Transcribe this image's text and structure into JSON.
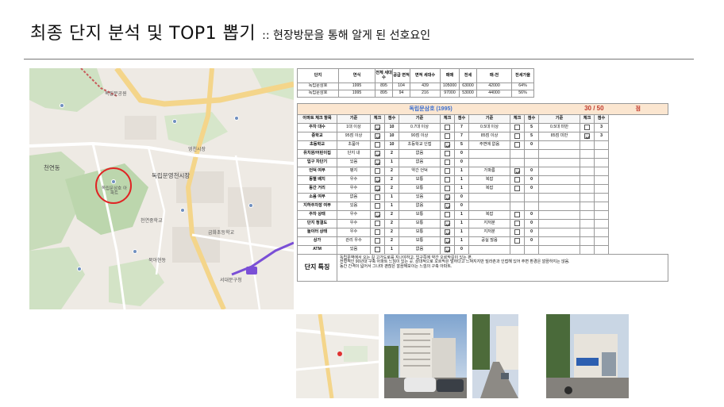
{
  "title": {
    "main": "최종 단지 분석 및 TOP1 뽑기",
    "sub": ":: 현장방문을 통해 알게 된 선호요인"
  },
  "map": {
    "labels": [
      "독립문공원",
      "천연동",
      "독립문영천시장",
      "독립문삼호 아파트",
      "영천시장",
      "천연중학교",
      "금화초등학교",
      "서대문구청",
      "북아현동"
    ],
    "circled": "독립문삼호 아파트"
  },
  "summary": {
    "headers": [
      "단지",
      "연식",
      "전체 세대수",
      "공급 면적",
      "면적 세대수",
      "매매",
      "전세",
      "매-전",
      "전세가율"
    ],
    "rows": [
      [
        "독립문삼호",
        "1995",
        "895",
        "104",
        "439",
        "105000",
        "63000",
        "42000",
        "64%"
      ],
      [
        "독립문삼호",
        "1995",
        "895",
        "94",
        "216",
        "97000",
        "53000",
        "44000",
        "56%"
      ]
    ]
  },
  "analysis": {
    "complex_name": "독립문삼호 (1995)",
    "total_score": "30 / 50",
    "score_unit": "점",
    "headers": [
      "아파트 체크 항목",
      "기준",
      "체크",
      "점수",
      "기준",
      "체크",
      "점수",
      "기준",
      "체크",
      "점수",
      "기준",
      "체크",
      "점수"
    ],
    "rows": [
      {
        "item": "주차 대수",
        "g": [
          [
            "1대 이상",
            true,
            "10"
          ],
          [
            "0.7대 이상",
            false,
            "7"
          ],
          [
            "0.5대 이상",
            false,
            "5"
          ],
          [
            "0.5대 미만",
            false,
            "3"
          ]
        ]
      },
      {
        "item": "중학교",
        "g": [
          [
            "95점 이상",
            true,
            "10"
          ],
          [
            "90점 이상",
            false,
            "7"
          ],
          [
            "85점 이상",
            false,
            "5"
          ],
          [
            "85점 미만",
            true,
            "3"
          ]
        ]
      },
      {
        "item": "초등학교",
        "g": [
          [
            "초품아",
            false,
            "10"
          ],
          [
            "초등학교 인접",
            true,
            "5"
          ],
          [
            "주변에 없음",
            false,
            "0"
          ],
          null
        ]
      },
      {
        "item": "유치원/어린이집",
        "g": [
          [
            "단지 내",
            true,
            "2"
          ],
          [
            "없음",
            false,
            "0"
          ],
          null,
          null
        ]
      },
      {
        "item": "입구 차단기",
        "g": [
          [
            "있음",
            true,
            "1"
          ],
          [
            "없음",
            false,
            "0"
          ],
          null,
          null
        ]
      },
      {
        "item": "언덕 여부",
        "g": [
          [
            "평지",
            false,
            "2"
          ],
          [
            "약간 언덕",
            false,
            "1"
          ],
          [
            "가파름",
            true,
            "0"
          ],
          null
        ]
      },
      {
        "item": "동별 배치",
        "g": [
          [
            "우수",
            true,
            "2"
          ],
          [
            "보통",
            false,
            "1"
          ],
          [
            "복잡",
            false,
            "0"
          ],
          null
        ]
      },
      {
        "item": "동간 거리",
        "g": [
          [
            "우수",
            true,
            "2"
          ],
          [
            "보통",
            false,
            "1"
          ],
          [
            "복잡",
            false,
            "0"
          ],
          null
        ]
      },
      {
        "item": "소음 여부",
        "g": [
          [
            "없음",
            false,
            "1"
          ],
          [
            "있음",
            true,
            "0"
          ],
          null,
          null
        ]
      },
      {
        "item": "지하주차장 여부",
        "g": [
          [
            "있음",
            false,
            "1"
          ],
          [
            "없음",
            true,
            "0"
          ],
          null,
          null
        ]
      },
      {
        "item": "주차 상태",
        "g": [
          [
            "우수",
            true,
            "2"
          ],
          [
            "보통",
            false,
            "1"
          ],
          [
            "복잡",
            false,
            "0"
          ],
          null
        ]
      },
      {
        "item": "단지 청결도",
        "g": [
          [
            "우수",
            false,
            "2"
          ],
          [
            "보통",
            true,
            "1"
          ],
          [
            "지저분",
            false,
            "0"
          ],
          null
        ]
      },
      {
        "item": "놀이터 상태",
        "g": [
          [
            "우수",
            false,
            "2"
          ],
          [
            "보통",
            true,
            "1"
          ],
          [
            "지저분",
            false,
            "0"
          ],
          null
        ]
      },
      {
        "item": "상가",
        "g": [
          [
            "관리 우수",
            false,
            "2"
          ],
          [
            "보통",
            true,
            "1"
          ],
          [
            "공실 많음",
            false,
            "0"
          ],
          null
        ]
      },
      {
        "item": "ATM",
        "g": [
          [
            "있음",
            false,
            "1"
          ],
          [
            "없음",
            true,
            "0"
          ],
          null,
          null
        ]
      }
    ],
    "feature_label": "단지 특징",
    "feature_lines": [
      "독립문역에서 오는 길 고가도로를 지나야하고, 입구쪽에 약간 오르막길이 있는 편.",
      "전형적인 90년대 구축 아파트 느낌이 있는 곳. 상대적으로 오르막은 덜하다고 느껴지지만 빌라촌과 인접해 있어 주변 환경은 깔끔하지는 않음.",
      "동간 간격이 넓어서 그나마 괜찮은 깔끔해보이는 느낌의 구축 아파트."
    ]
  }
}
